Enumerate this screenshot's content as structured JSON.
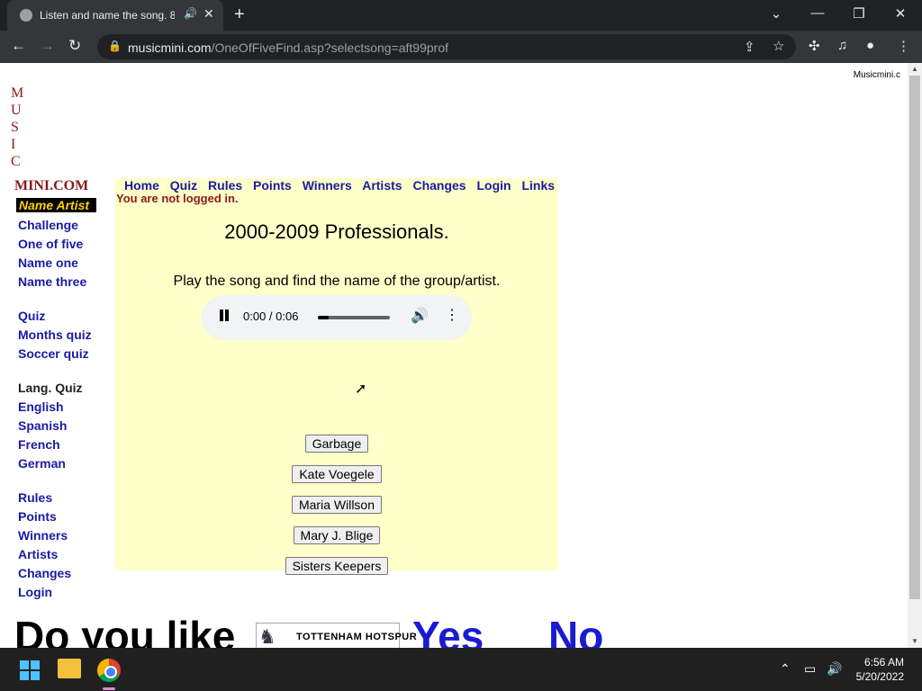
{
  "browser": {
    "tab_title": "Listen and name the song. 8(",
    "tab_audio_icon": "speaker-icon",
    "url_domain": "musicmini.com",
    "url_path": "/OneOfFiveFind.asp?selectsong=aft99prof"
  },
  "page": {
    "corner_text": "Musicmini.c",
    "logo_letters": [
      "M",
      "U",
      "S",
      "I",
      "C"
    ],
    "logo_base": "MINI.COM",
    "sidebar": {
      "name_artist": "Name Artist",
      "group1": [
        "Challenge",
        "One of five",
        "Name one",
        "Name three"
      ],
      "group2": [
        "Quiz",
        "Months quiz",
        "Soccer quiz"
      ],
      "lang_label": "Lang. Quiz",
      "group3": [
        "English",
        "Spanish",
        "French",
        "German"
      ],
      "group4": [
        "Rules",
        "Points",
        "Winners",
        "Artists",
        "Changes",
        "Login"
      ]
    },
    "topnav": [
      "Home",
      "Quiz",
      "Rules",
      "Points",
      "Winners",
      "Artists",
      "Changes",
      "Login",
      "Links"
    ],
    "login_status": "You are not logged in.",
    "heading": "2000-2009 Professionals.",
    "instruction": "Play the song and find the name of the group/artist.",
    "player": {
      "time": "0:00 / 0:06",
      "progress": 0.15
    },
    "choices": [
      "Garbage",
      "Kate Voegele",
      "Maria Willson",
      "Mary J. Blige",
      "Sisters Keepers"
    ],
    "promo": {
      "question": "Do you like",
      "team": "TOTTENHAM HOTSPUR",
      "yes": "Yes",
      "no": "No"
    }
  },
  "taskbar": {
    "time": "6:56 AM",
    "date": "5/20/2022"
  }
}
